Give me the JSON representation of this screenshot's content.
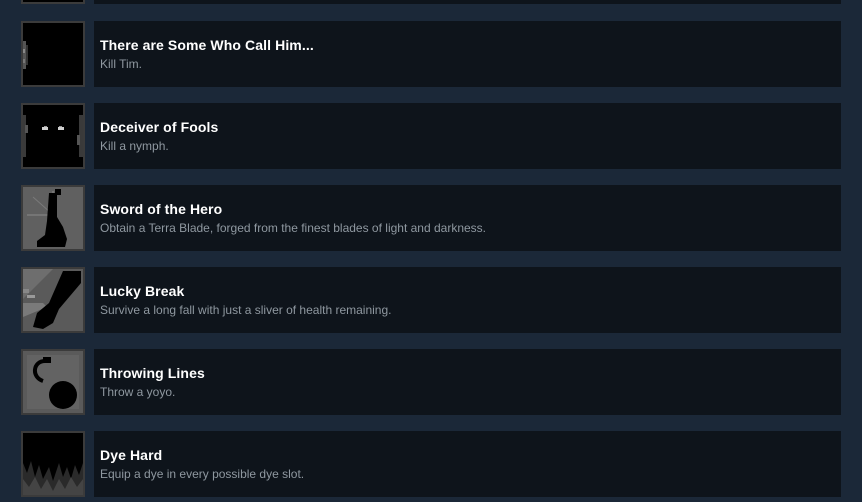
{
  "achievements": [
    {
      "title": "There are Some Who Call Him...",
      "description": "Kill Tim.",
      "icon": "dark-tim-icon"
    },
    {
      "title": "Deceiver of Fools",
      "description": "Kill a nymph.",
      "icon": "glowing-eyes-icon"
    },
    {
      "title": "Sword of the Hero",
      "description": "Obtain a Terra Blade, forged from the finest blades of light and darkness.",
      "icon": "sword-icon"
    },
    {
      "title": "Lucky Break",
      "description": "Survive a long fall with just a sliver of health remaining.",
      "icon": "broken-bone-icon"
    },
    {
      "title": "Throwing Lines",
      "description": "Throw a yoyo.",
      "icon": "yoyo-icon"
    },
    {
      "title": "Dye Hard",
      "description": "Equip a dye in every possible dye slot.",
      "icon": "dye-flames-icon"
    }
  ]
}
